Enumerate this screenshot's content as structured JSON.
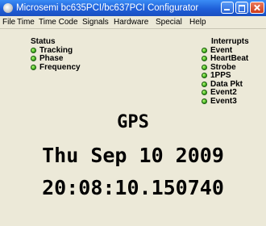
{
  "window": {
    "title": "Microsemi bc635PCI/bc637PCI Configurator",
    "icon": "app-globe-icon"
  },
  "menu": {
    "items": [
      "File",
      "Time",
      "Time Code",
      "Signals",
      "Hardware",
      "Special",
      "Help"
    ]
  },
  "status": {
    "heading": "Status",
    "items": [
      {
        "label": "Tracking",
        "indicator_color": "#3aa818"
      },
      {
        "label": "Phase",
        "indicator_color": "#3aa818"
      },
      {
        "label": "Frequency",
        "indicator_color": "#3aa818"
      }
    ]
  },
  "interrupts": {
    "heading": "Interrupts",
    "items": [
      {
        "label": "Event",
        "indicator_color": "#3aa818"
      },
      {
        "label": "HeartBeat",
        "indicator_color": "#3aa818"
      },
      {
        "label": "Strobe",
        "indicator_color": "#3aa818"
      },
      {
        "label": "1PPS",
        "indicator_color": "#3aa818"
      },
      {
        "label": "Data Pkt",
        "indicator_color": "#3aa818"
      },
      {
        "label": "Event2",
        "indicator_color": "#3aa818"
      },
      {
        "label": "Event3",
        "indicator_color": "#3aa818"
      }
    ]
  },
  "display": {
    "source": "GPS",
    "date": "Thu Sep 10 2009",
    "time": "20:08:10.150740"
  }
}
